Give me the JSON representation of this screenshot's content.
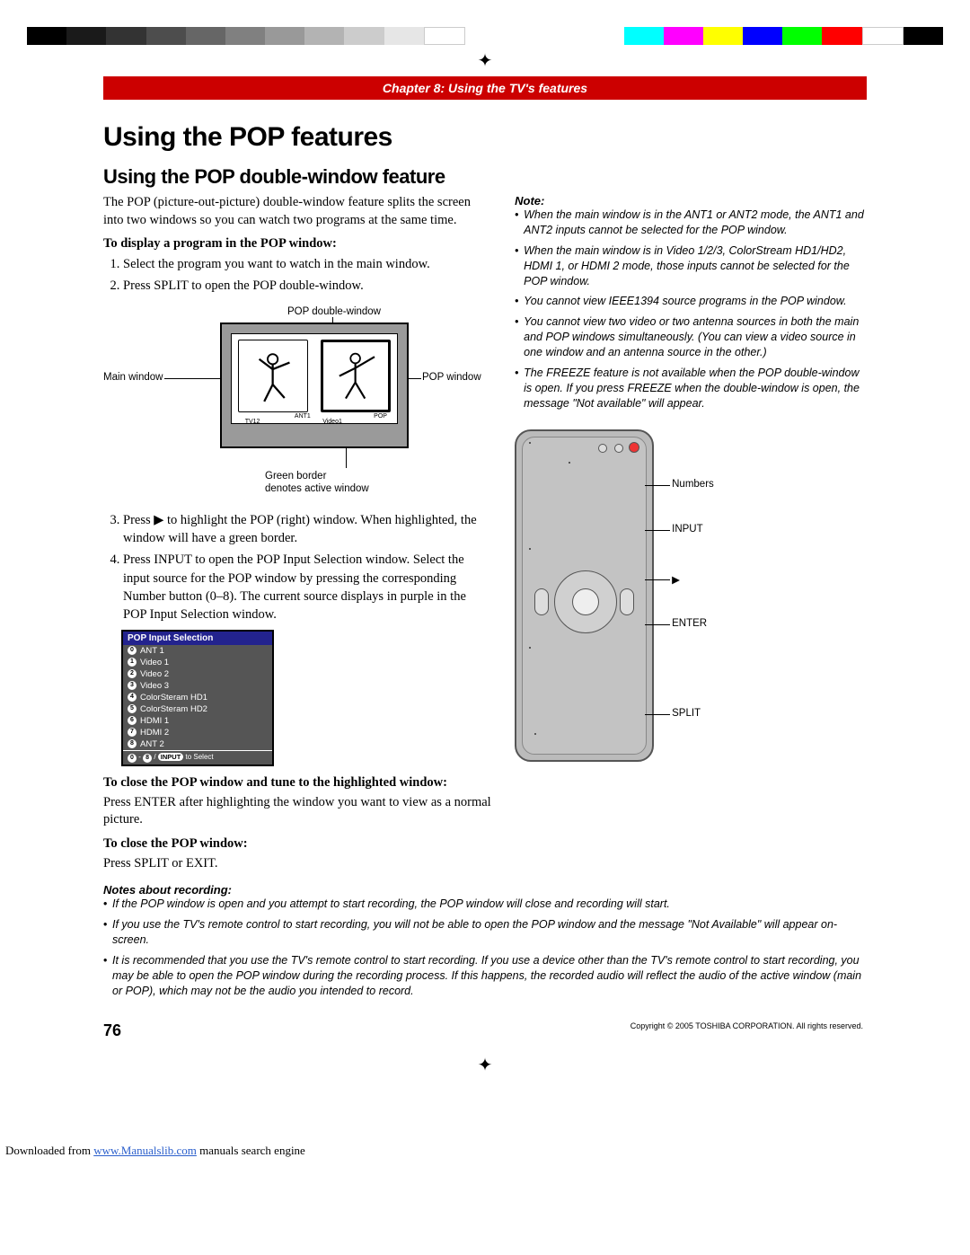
{
  "banner": "Chapter 8: Using the TV's features",
  "h1": "Using the POP features",
  "h2": "Using the POP double-window feature",
  "intro": "The POP (picture-out-picture) double-window feature splits the screen into two windows so you can watch two programs at the same time.",
  "sub1": "To display a program in the POP window:",
  "step1": "Select the program you want to watch in the main window.",
  "step2": "Press SPLIT to open the POP double-window.",
  "diagram": {
    "top": "POP double-window",
    "left": "Main window",
    "right": "POP window",
    "bottom1": "Green border",
    "bottom2": "denotes active window",
    "ant1": "ANT1",
    "tv12": "TV12",
    "pop": "POP",
    "video1": "Video1"
  },
  "step3": "Press ▶ to highlight the POP (right) window. When highlighted, the window will have a green border.",
  "step4": "Press INPUT to open the POP Input Selection window. Select the input source for the POP window by pressing the corresponding Number button (0–8). The current source displays in purple in the POP Input Selection window.",
  "inputSel": {
    "title": "POP Input Selection",
    "items": [
      "ANT 1",
      "Video 1",
      "Video 2",
      "Video 3",
      "ColorSteram HD1",
      "ColorSteram HD2",
      "HDMI 1",
      "HDMI 2",
      "ANT 2"
    ],
    "foot_a": "0",
    "foot_b": "8",
    "foot_sep": " - ",
    "foot_slash": " / ",
    "foot_input": "INPUT",
    "foot_tail": " to Select"
  },
  "sub2": "To close the POP window and tune to the highlighted window:",
  "p2": "Press ENTER after highlighting the window you want to view as a normal picture.",
  "sub3": "To close the POP window:",
  "p3": "Press SPLIT or EXIT.",
  "notesRecHdr": "Notes about recording:",
  "notesRec": [
    "If the POP window is open and you attempt to start recording, the POP window will close and recording will start.",
    "If you use the TV's remote control to start recording, you will not be able to open the POP window and the message \"Not Available\" will appear on-screen.",
    "It is recommended that you use the TV's remote control to start recording. If you use a device other than the TV's remote control to start recording, you may be able to open the POP window during the recording process. If this happens, the recorded audio will reflect the audio of the active window (main or POP), which may not be the audio you intended to record."
  ],
  "noteHdr": "Note:",
  "notes": [
    "When the main window is in the ANT1 or ANT2 mode, the ANT1 and ANT2 inputs cannot be selected for the POP window.",
    "When the main window is in Video 1/2/3, ColorStream HD1/HD2, HDMI 1, or HDMI 2 mode, those inputs cannot be selected for the POP window.",
    "You cannot view IEEE1394 source programs in the POP window.",
    "You cannot view two video or two antenna sources in both the main and POP windows simultaneously. (You can view a video source in one window and an antenna source in the other.)",
    "The FREEZE feature is not available when the POP double-window is open. If you press FREEZE when the double-window is open, the message \"Not available\" will appear."
  ],
  "remoteLabels": {
    "numbers": "Numbers",
    "input": "INPUT",
    "right": "▶",
    "enter": "ENTER",
    "split": "SPLIT"
  },
  "pageNum": "76",
  "copyright": "Copyright © 2005 TOSHIBA CORPORATION. All rights reserved.",
  "footer": {
    "pre": "Downloaded from ",
    "link": "www.Manualslib.com",
    "post": " manuals search engine"
  }
}
